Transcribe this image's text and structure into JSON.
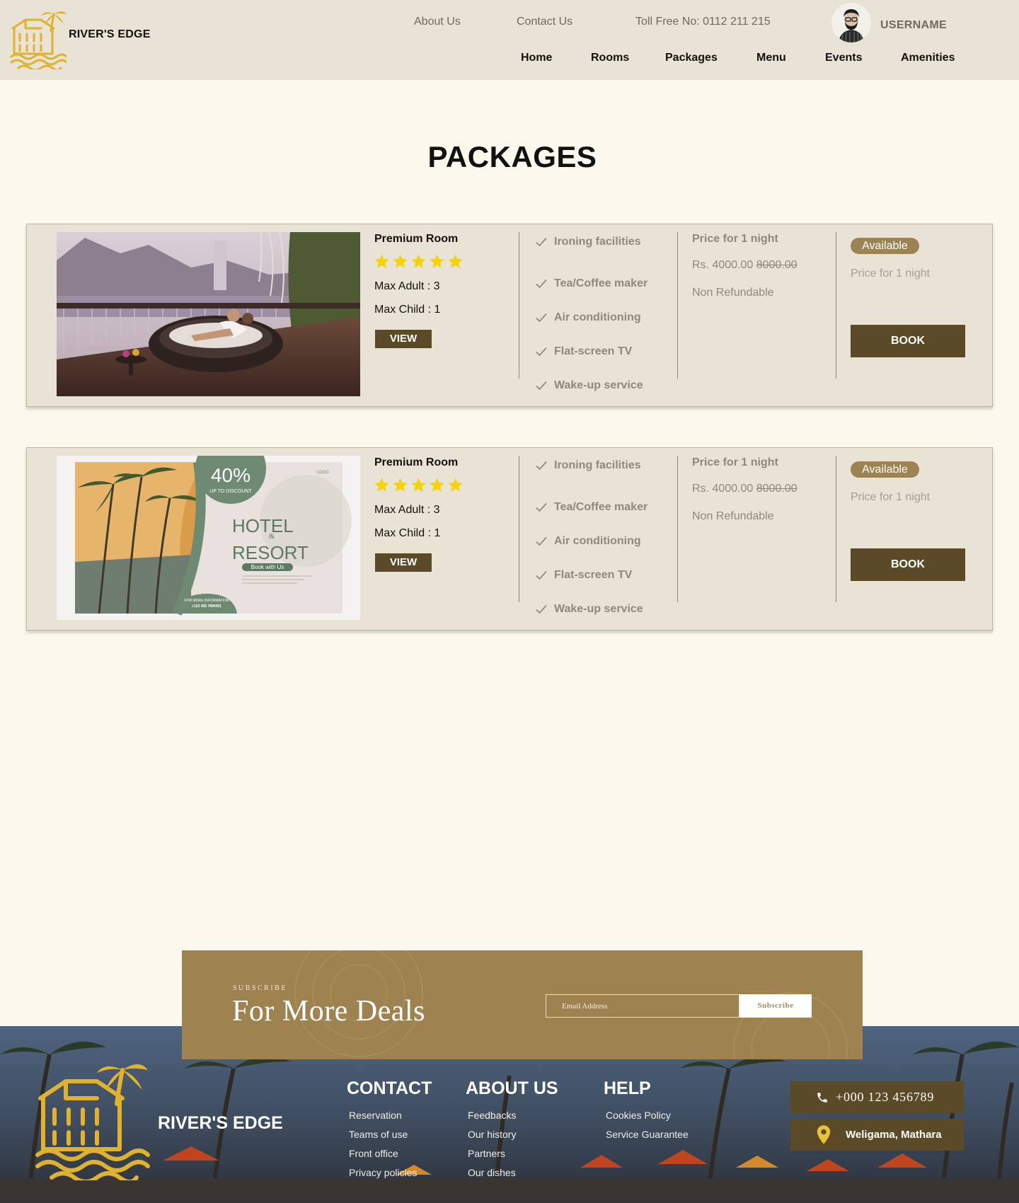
{
  "header": {
    "brand": "RIVER'S EDGE",
    "top_links": [
      "About Us",
      "Contact Us"
    ],
    "toll_free": "Toll Free No: 0112 211 215",
    "username": "USERNAME",
    "nav": [
      "Home",
      "Rooms",
      "Packages",
      "Menu",
      "Events",
      "Amenities"
    ]
  },
  "page_title": "PACKAGES",
  "packages": [
    {
      "title": "Premium Room",
      "rating": 5,
      "max_adult": "Max Adult : 3",
      "max_child": "Max Child : 1",
      "view_label": "VIEW",
      "amenities": [
        "Ironing facilities",
        "Tea/Coffee maker",
        "Air conditioning",
        "Flat-screen TV",
        "Wake-up service"
      ],
      "price_heading": "Price for 1 night",
      "price": "Rs. 4000.00",
      "old_price": "8000.00",
      "refund": "Non Refundable",
      "availability": "Available",
      "avail_price_label": "Price for 1 night",
      "book_label": "BOOK"
    },
    {
      "title": "Premium Room",
      "rating": 5,
      "max_adult": "Max Adult : 3",
      "max_child": "Max Child : 1",
      "view_label": "VIEW",
      "amenities": [
        "Ironing facilities",
        "Tea/Coffee maker",
        "Air conditioning",
        "Flat-screen TV",
        "Wake-up service"
      ],
      "price_heading": "Price for 1 night",
      "price": "Rs. 4000.00",
      "old_price": "8000.00",
      "refund": "Non Refundable",
      "availability": "Available",
      "avail_price_label": "Price for 1 night",
      "book_label": "BOOK",
      "promo": {
        "discount": "40%",
        "discount_sub": "UP TO DISCOUNT",
        "logo": "LOGO",
        "line1": "HOTEL",
        "amp": "&",
        "line2": "RESORT",
        "cta": "Book with Us",
        "info_label": "FOR MORE INFORMATION",
        "info_phone": "+123 456 7890001"
      }
    }
  ],
  "subscribe": {
    "label": "SUBSCRIBE",
    "title": "For More Deals",
    "email_placeholder": "Email Address",
    "button": "Subscribe"
  },
  "footer": {
    "brand": "RIVER'S EDGE",
    "columns": [
      {
        "title": "CONTACT",
        "links": [
          "Reservation",
          "Teams of use",
          "Front office",
          "Privacy policies"
        ]
      },
      {
        "title": "ABOUT US",
        "links": [
          "Feedbacks",
          "Our history",
          "Partners",
          "Our dishes"
        ]
      },
      {
        "title": "HELP",
        "links": [
          "Cookies Policy",
          "Service Guarantee"
        ]
      }
    ],
    "phone": "+000 123 456789",
    "location": "Weligama, Mathara"
  },
  "colors": {
    "header_bg": "#e8e3d4",
    "page_bg": "#fbf8ee",
    "accent_dark": "#5a4a27",
    "accent_gold": "#9e8250",
    "logo_gold": "#e0b22e",
    "star": "#f5d20b"
  },
  "icons": {
    "logo": "house-palm-logo",
    "star": "star-icon",
    "check": "check-icon",
    "phone": "phone-icon",
    "location": "map-pin-icon"
  }
}
